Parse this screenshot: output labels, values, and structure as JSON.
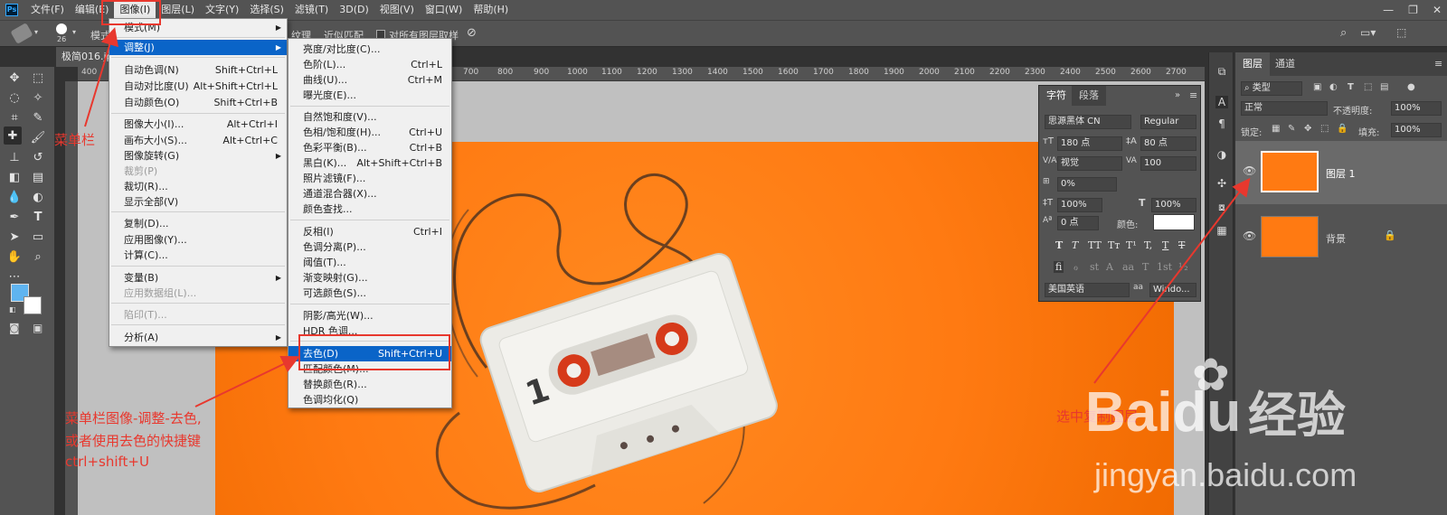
{
  "menubar": {
    "logo": "Ps",
    "items": [
      "文件(F)",
      "编辑(E)",
      "图像(I)",
      "图层(L)",
      "文字(Y)",
      "选择(S)",
      "滤镜(T)",
      "3D(D)",
      "视图(V)",
      "窗口(W)",
      "帮助(H)"
    ],
    "window_controls": [
      "—",
      "❐",
      "✕"
    ]
  },
  "options_bar": {
    "brush_size": "26",
    "mode_label": "模式",
    "texture_label": "纹理",
    "proximity_label": "近似匹配",
    "sample_all_label": "对所有图层取样"
  },
  "document": {
    "tab_title": "极简016.jp",
    "ruler_ticks": [
      "400",
      "700",
      "800",
      "900",
      "1000",
      "1100",
      "1200",
      "1300",
      "1400",
      "1500",
      "1600",
      "1700",
      "1800",
      "1900",
      "2000",
      "2100",
      "2200",
      "2300",
      "2400",
      "2500",
      "2600",
      "2700"
    ]
  },
  "image_menu": {
    "items": [
      {
        "label": "模式(M)",
        "submenu": true
      },
      {
        "label": "调整(J)",
        "submenu": true,
        "highlight": true
      },
      {
        "label": "自动色调(N)",
        "shortcut": "Shift+Ctrl+L"
      },
      {
        "label": "自动对比度(U)",
        "shortcut": "Alt+Shift+Ctrl+L"
      },
      {
        "label": "自动颜色(O)",
        "shortcut": "Shift+Ctrl+B"
      },
      {
        "label": "图像大小(I)...",
        "shortcut": "Alt+Ctrl+I"
      },
      {
        "label": "画布大小(S)...",
        "shortcut": "Alt+Ctrl+C"
      },
      {
        "label": "图像旋转(G)",
        "submenu": true
      },
      {
        "label": "裁剪(P)",
        "disabled": true
      },
      {
        "label": "裁切(R)..."
      },
      {
        "label": "显示全部(V)"
      },
      {
        "label": "复制(D)..."
      },
      {
        "label": "应用图像(Y)..."
      },
      {
        "label": "计算(C)..."
      },
      {
        "label": "变量(B)",
        "submenu": true
      },
      {
        "label": "应用数据组(L)...",
        "disabled": true
      },
      {
        "label": "陷印(T)...",
        "disabled": true
      },
      {
        "label": "分析(A)",
        "submenu": true
      }
    ]
  },
  "adjust_menu": {
    "items": [
      {
        "label": "亮度/对比度(C)..."
      },
      {
        "label": "色阶(L)...",
        "shortcut": "Ctrl+L"
      },
      {
        "label": "曲线(U)...",
        "shortcut": "Ctrl+M"
      },
      {
        "label": "曝光度(E)..."
      },
      {
        "label": "自然饱和度(V)..."
      },
      {
        "label": "色相/饱和度(H)...",
        "shortcut": "Ctrl+U"
      },
      {
        "label": "色彩平衡(B)...",
        "shortcut": "Ctrl+B"
      },
      {
        "label": "黑白(K)...",
        "shortcut": "Alt+Shift+Ctrl+B"
      },
      {
        "label": "照片滤镜(F)..."
      },
      {
        "label": "通道混合器(X)..."
      },
      {
        "label": "颜色查找..."
      },
      {
        "label": "反相(I)",
        "shortcut": "Ctrl+I"
      },
      {
        "label": "色调分离(P)..."
      },
      {
        "label": "阈值(T)..."
      },
      {
        "label": "渐变映射(G)..."
      },
      {
        "label": "可选颜色(S)..."
      },
      {
        "label": "阴影/高光(W)..."
      },
      {
        "label": "HDR 色调..."
      },
      {
        "label": "去色(D)",
        "shortcut": "Shift+Ctrl+U",
        "highlight": true
      },
      {
        "label": "匹配颜色(M)..."
      },
      {
        "label": "替换颜色(R)..."
      },
      {
        "label": "色调均化(Q)"
      }
    ]
  },
  "character_panel": {
    "tabs": [
      "字符",
      "段落"
    ],
    "font_family": "思源黑体 CN",
    "font_style": "Regular",
    "font_size": "180 点",
    "leading": "80 点",
    "kerning": "视觉",
    "tracking": "100",
    "tsume": "0%",
    "vertical_scale": "100%",
    "horizontal_scale": "100%",
    "baseline_shift": "0 点",
    "color_label": "颜色:",
    "style_buttons": [
      "T",
      "T",
      "TT",
      "Tт",
      "T¹",
      "T,",
      "T",
      "T"
    ],
    "opentype_buttons": [
      "fi",
      "ℴ",
      "st",
      "A",
      "aa",
      "T",
      "1st",
      "½"
    ],
    "language": "美国英语",
    "antialias": "Windo..."
  },
  "layers_panel": {
    "tabs": [
      "图层",
      "通道"
    ],
    "filter_kind": "类型",
    "blend_mode": "正常",
    "opacity_label": "不透明度:",
    "opacity_value": "100%",
    "lock_label": "锁定:",
    "fill_label": "填充:",
    "fill_value": "100%",
    "layers": [
      {
        "name": "图层 1",
        "selected": true
      },
      {
        "name": "背景",
        "locked": true
      }
    ]
  },
  "annotations": {
    "menubar_label": "菜单栏",
    "menu_path_line1": "菜单栏图像-调整-去色,",
    "menu_path_line2": "或者使用去色的快捷键",
    "menu_path_line3": "ctrl+shift+U",
    "select_layer": "选中复制图层"
  },
  "watermark": {
    "brand": "Baidu",
    "brand_suffix": "经验",
    "url": "jingyan.baidu.com"
  },
  "colors": {
    "accent_red": "#e8382e",
    "menu_highlight": "#0a64c8",
    "foreground_swatch": "#5fb4f0",
    "artwork_orange": "#ff7a12"
  }
}
